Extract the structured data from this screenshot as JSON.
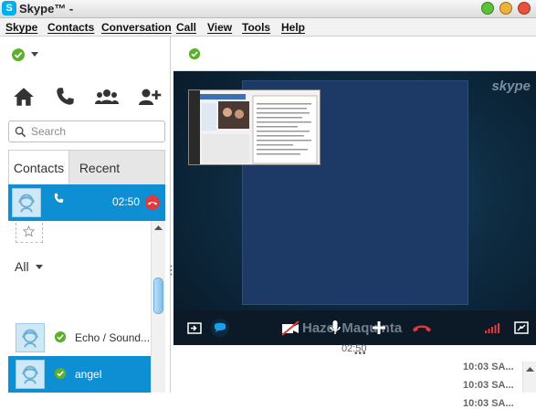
{
  "window": {
    "title": "Skype™ -",
    "logo_letter": "S"
  },
  "menu": [
    "Skype",
    "Contacts",
    "Conversation",
    "Call",
    "View",
    "Tools",
    "Help"
  ],
  "search": {
    "placeholder": "Search"
  },
  "tabs": {
    "contacts": "Contacts",
    "recent": "Recent"
  },
  "active_call": {
    "duration": "02:50"
  },
  "contacts_list": {
    "group_label": "All",
    "items": [
      {
        "name": "Echo / Sound...",
        "selected": false
      },
      {
        "name": "angel",
        "selected": true
      },
      {
        "name": "",
        "selected": false
      }
    ]
  },
  "call": {
    "contact_name": "Hazel Maquinta",
    "timer": "02:50",
    "skype_watermark": "skype",
    "message_times": [
      "10:03 SA...",
      "10:03 SA...",
      "10:03 SA..."
    ]
  },
  "colors": {
    "accent": "#0e8fd4",
    "online": "#5bb02d",
    "hangup": "#e23a3a"
  }
}
